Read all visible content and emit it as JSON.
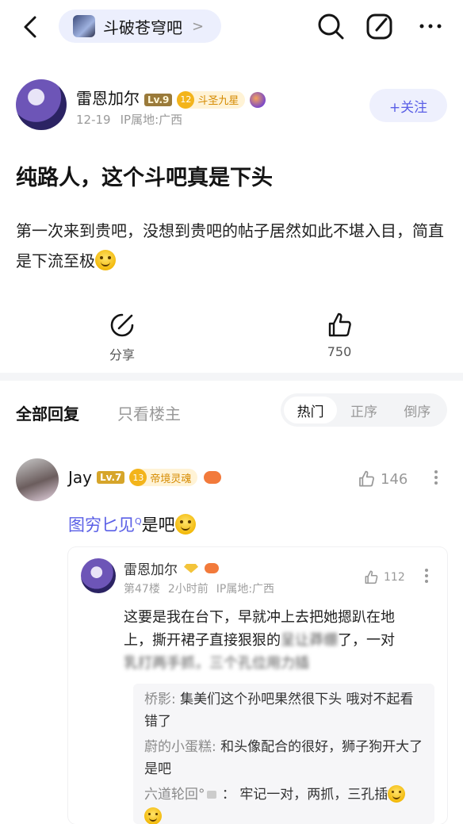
{
  "header": {
    "forum_name": "斗破苍穹吧",
    "forum_chevron": ">"
  },
  "author": {
    "name": "雷恩加尔",
    "level": "Lv.9",
    "rank_number": "12",
    "rank_title": "斗圣九星",
    "date": "12-19",
    "ip": "IP属地:广西",
    "follow_label": "+关注"
  },
  "post": {
    "title": "纯路人，这个斗吧真是下头",
    "body": "第一次来到贵吧，没想到贵吧的帖子居然如此不堪入目，简直是下流至极"
  },
  "actions": {
    "share_label": "分享",
    "like_count": "750"
  },
  "replies": {
    "all_label": "全部回复",
    "op_only_label": "只看楼主",
    "sort_hot": "热门",
    "sort_asc": "正序",
    "sort_desc": "倒序"
  },
  "comment": {
    "user": "Jay",
    "level": "Lv.7",
    "rank_number": "13",
    "rank_title": "帝境灵魂",
    "likes": "146",
    "topic_link": "图穷匕见",
    "topic_mark": "Q",
    "text": "是吧"
  },
  "nested_reply": {
    "user": "雷恩加尔",
    "floor": "第47楼",
    "time": "2小时前",
    "ip": "IP属地:广西",
    "likes": "112",
    "text_line1": "这要是我在台下，早就冲上去把她摁趴在地",
    "text_line2": "上，撕开裙子直接狠狠的",
    "text_blur1": "呈让莽绷",
    "text_line2_end": "了，一对",
    "text_blur2": "乳打两手抓，三个孔位用力插",
    "sub_replies": [
      {
        "user": "桥影:",
        "text": "集美们这个孙吧果然很下头 哦对不起看错了"
      },
      {
        "user": "蔚的小蛋糕:",
        "text": "和头像配合的很好，狮子狗开大了是吧"
      },
      {
        "user": "六道轮回°",
        "text": "牢记一对，两抓，三孔插"
      }
    ]
  }
}
